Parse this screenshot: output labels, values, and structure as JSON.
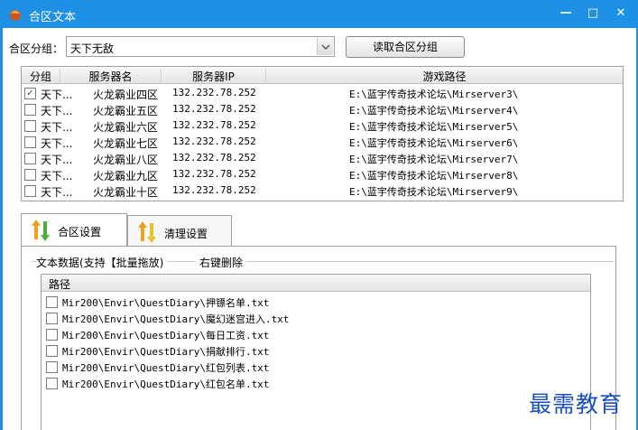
{
  "window": {
    "title": "合区文本",
    "minimize": "—",
    "maximize": "□",
    "close": "✕"
  },
  "group_select": {
    "label": "合区分组：",
    "value": "天下无敌",
    "button": "读取合区分组"
  },
  "server_table": {
    "columns": [
      "分组",
      "服务器名",
      "服务器IP",
      "游戏路径"
    ],
    "rows": [
      {
        "checked": true,
        "group": "天下...",
        "name": "火龙霸业四区",
        "ip": "132.232.78.252",
        "path": "E:\\蓝宇传奇技术论坛\\Mirserver3\\"
      },
      {
        "checked": false,
        "group": "天下...",
        "name": "火龙霸业五区",
        "ip": "132.232.78.252",
        "path": "E:\\蓝宇传奇技术论坛\\Mirserver4\\"
      },
      {
        "checked": false,
        "group": "天下...",
        "name": "火龙霸业六区",
        "ip": "132.232.78.252",
        "path": "E:\\蓝宇传奇技术论坛\\Mirserver5\\"
      },
      {
        "checked": false,
        "group": "天下...",
        "name": "火龙霸业七区",
        "ip": "132.232.78.252",
        "path": "E:\\蓝宇传奇技术论坛\\Mirserver6\\"
      },
      {
        "checked": false,
        "group": "天下...",
        "name": "火龙霸业八区",
        "ip": "132.232.78.252",
        "path": "E:\\蓝宇传奇技术论坛\\Mirserver7\\"
      },
      {
        "checked": false,
        "group": "天下...",
        "name": "火龙霸业九区",
        "ip": "132.232.78.252",
        "path": "E:\\蓝宇传奇技术论坛\\Mirserver8\\"
      },
      {
        "checked": false,
        "group": "天下...",
        "name": "火龙霸业十区",
        "ip": "132.232.78.252",
        "path": "E:\\蓝宇传奇技术论坛\\Mirserver9\\"
      }
    ]
  },
  "tabs": [
    {
      "label": "合区设置",
      "active": true
    },
    {
      "label": "清理设置",
      "active": false
    }
  ],
  "text_data": {
    "legend": "文本数据(支持【批量拖放)",
    "hint": "右键删除",
    "column": "路径",
    "rows": [
      "Mir200\\Envir\\QuestDiary\\押镖名单.txt",
      "Mir200\\Envir\\QuestDiary\\魔幻迷宫进入.txt",
      "Mir200\\Envir\\QuestDiary\\每日工资.txt",
      "Mir200\\Envir\\QuestDiary\\捐献排行.txt",
      "Mir200\\Envir\\QuestDiary\\红包列表.txt",
      "Mir200\\Envir\\QuestDiary\\红包名单.txt"
    ]
  },
  "watermark": "最需教育",
  "colors": {
    "titlebar": "#1e90e6",
    "watermark": "#1a4fc2"
  }
}
